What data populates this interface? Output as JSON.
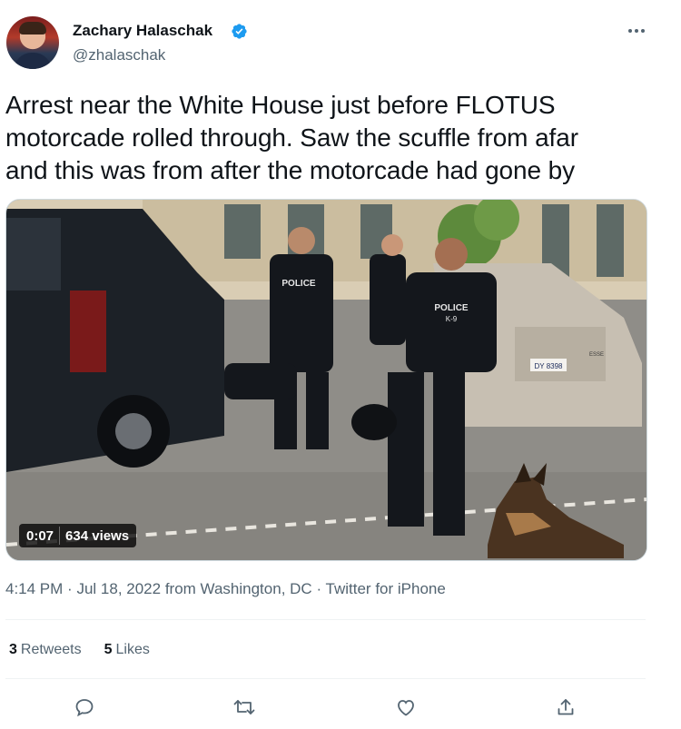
{
  "author": {
    "display_name": "Zachary Halaschak",
    "handle": "@zhalaschak",
    "verified": true
  },
  "tweet": {
    "text": "Arrest near the White House just before FLOTUS\nmotorcade rolled through. Saw the scuffle from afar\nand this was from after the motorcade had gone by"
  },
  "media": {
    "type": "video",
    "duration": "0:07",
    "views": "634 views",
    "scene_text": {
      "vest_left": "POLICE",
      "vest_right": "POLICE",
      "vest_right_sub": "K-9",
      "car_badge": "ESSE",
      "plate": "DY 8398"
    }
  },
  "meta": {
    "time": "4:14 PM",
    "date": "Jul 18, 2022",
    "location": "from Washington, DC",
    "source": "Twitter for iPhone",
    "separator": "·"
  },
  "stats": {
    "retweets_count": "3",
    "retweets_label": "Retweets",
    "likes_count": "5",
    "likes_label": "Likes"
  },
  "actions": [
    {
      "name": "reply-icon"
    },
    {
      "name": "retweet-icon"
    },
    {
      "name": "like-icon"
    },
    {
      "name": "share-icon"
    }
  ],
  "colors": {
    "text": "#0f1419",
    "secondary": "#536471",
    "verified_blue": "#1d9bf0",
    "divider": "#eff3f4"
  }
}
